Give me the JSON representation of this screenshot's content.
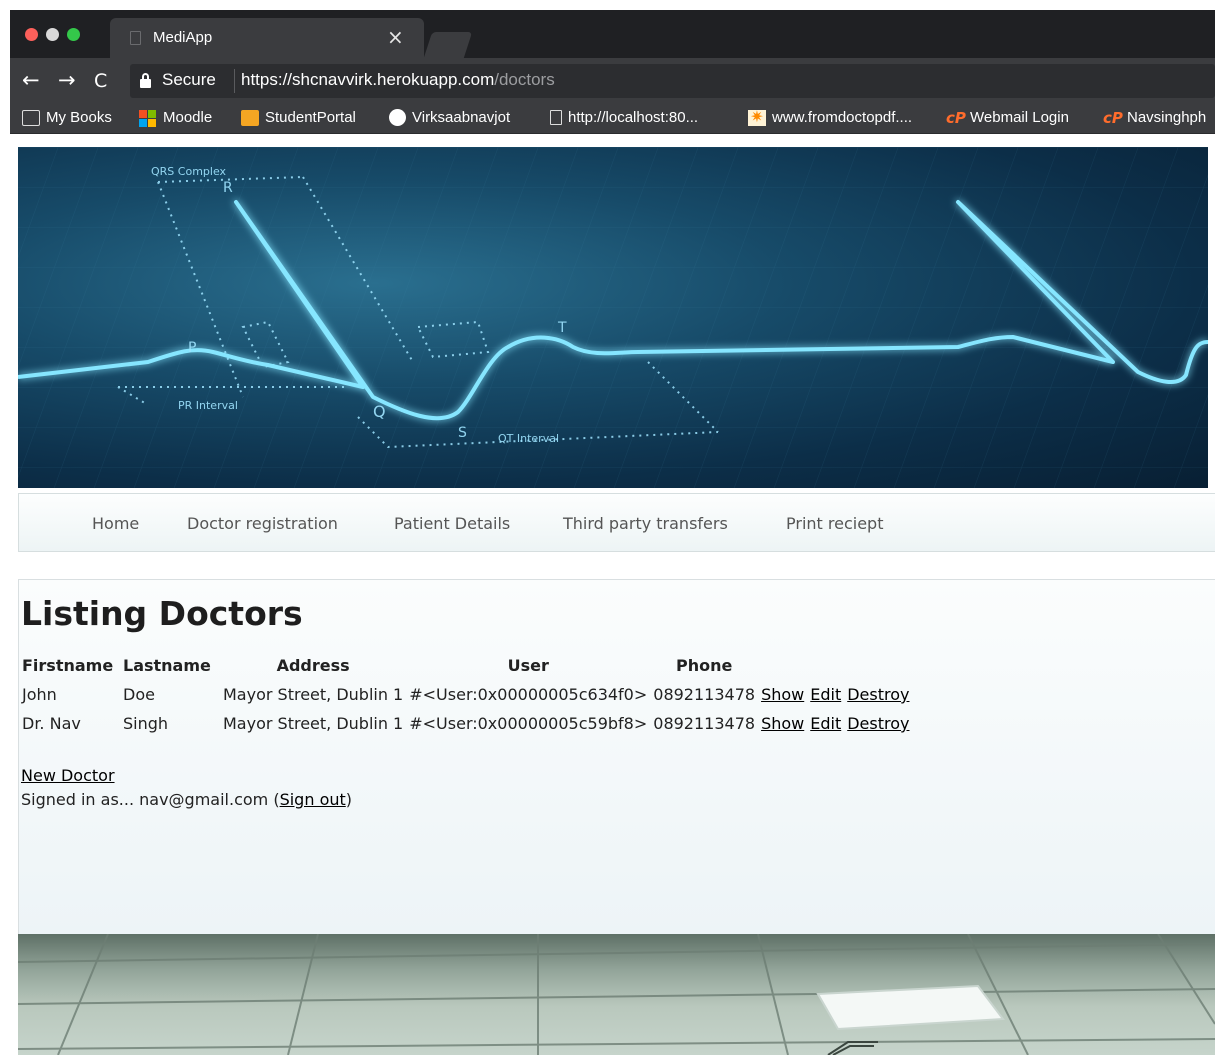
{
  "browser": {
    "tab_title": "MediApp",
    "tab_close": "×",
    "nav": {
      "back": "←",
      "forward": "→",
      "reload": "C"
    },
    "secure_label": "Secure",
    "url_main": "https://shcnavvirk.herokuapp.com",
    "url_path": "/doctors",
    "bookmarks": [
      {
        "label": "My Books",
        "icon": "folder-icon"
      },
      {
        "label": "Moodle",
        "icon": "microsoft-icon"
      },
      {
        "label": "StudentPortal",
        "icon": "studentportal-icon"
      },
      {
        "label": "Virksaabnavjot",
        "icon": "github-icon"
      },
      {
        "label": "http://localhost:80...",
        "icon": "page-icon"
      },
      {
        "label": "www.fromdoctopdf....",
        "icon": "star-icon"
      },
      {
        "label": "Webmail Login",
        "icon": "cpanel-icon"
      },
      {
        "label": "Navsinghph",
        "icon": "cpanel-icon"
      }
    ]
  },
  "banner": {
    "labels": {
      "qrs": "QRS Complex",
      "r": "R",
      "p": "P",
      "t": "T",
      "q": "Q",
      "s": "S",
      "pr": "PR Interval",
      "qt": "QT Interval"
    }
  },
  "navbar": {
    "items": [
      "Home",
      "Doctor registration",
      "Patient Details",
      "Third party transfers",
      "Print reciept"
    ]
  },
  "page": {
    "title": "Listing Doctors",
    "columns": [
      "Firstname",
      "Lastname",
      "Address",
      "User",
      "Phone"
    ],
    "rows": [
      {
        "firstname": "John",
        "lastname": "Doe",
        "address": "Mayor Street, Dublin 1",
        "user": "#<User:0x00000005c634f0>",
        "phone": "0892113478"
      },
      {
        "firstname": "Dr. Nav",
        "lastname": "Singh",
        "address": "Mayor Street, Dublin 1",
        "user": "#<User:0x00000005c59bf8>",
        "phone": "0892113478"
      }
    ],
    "actions": {
      "show": "Show",
      "edit": "Edit",
      "destroy": "Destroy"
    },
    "new_doctor": "New Doctor",
    "signed_in_prefix": "Signed in as... nav@gmail.com (",
    "sign_out": "Sign out",
    "signed_in_suffix": ")"
  },
  "colors": {
    "banner_dark": "#0c2e48",
    "ecg_glow": "#7fe0ff",
    "chrome": "#3b3c3f"
  }
}
